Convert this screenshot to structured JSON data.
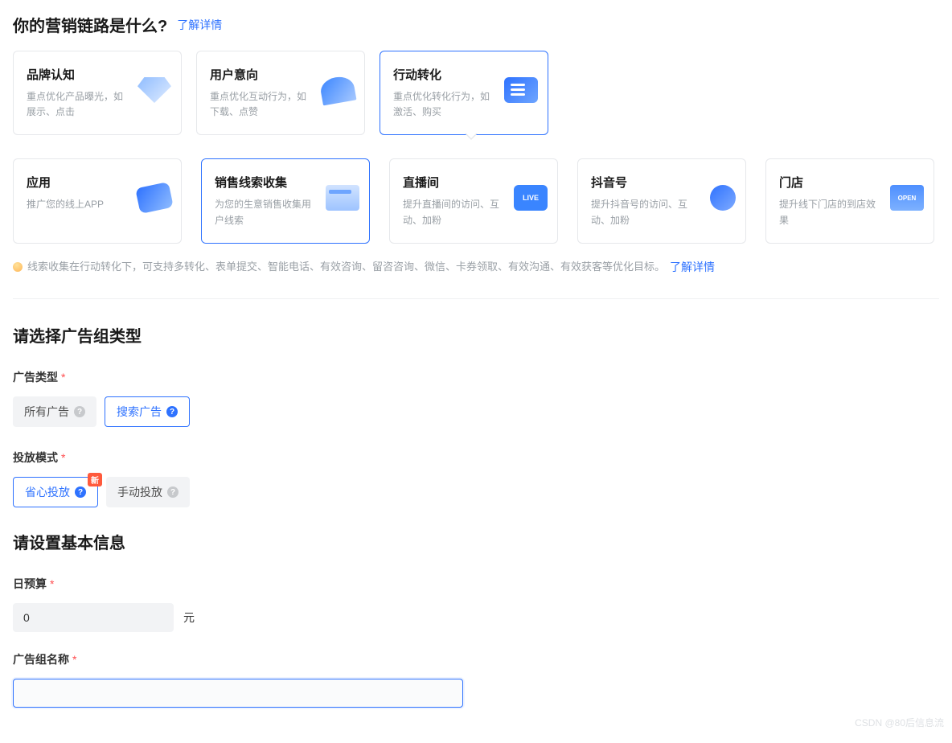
{
  "s1": {
    "title": "你的营销链路是什么?",
    "link": "了解详情",
    "cards": [
      {
        "title": "品牌认知",
        "desc": "重点优化产品曝光，如展示、点击"
      },
      {
        "title": "用户意向",
        "desc": "重点优化互动行为，如下载、点赞"
      },
      {
        "title": "行动转化",
        "desc": "重点优化转化行为，如激活、购买"
      }
    ],
    "sub": [
      {
        "title": "应用",
        "desc": "推广您的线上APP"
      },
      {
        "title": "销售线索收集",
        "desc": "为您的生意销售收集用户线索"
      },
      {
        "title": "直播间",
        "desc": "提升直播间的访问、互动、加粉"
      },
      {
        "title": "抖音号",
        "desc": "提升抖音号的访问、互动、加粉"
      },
      {
        "title": "门店",
        "desc": "提升线下门店的到店效果"
      }
    ],
    "hint": "线索收集在行动转化下，可支持多转化、表单提交、智能电话、有效咨询、留咨咨询、微信、卡券领取、有效沟通、有效获客等优化目标。",
    "hintLink": "了解详情"
  },
  "s2": {
    "title": "请选择广告组类型",
    "adTypeLabel": "广告类型",
    "adTypes": [
      "所有广告",
      "搜索广告"
    ],
    "modeLabel": "投放模式",
    "modes": [
      "省心投放",
      "手动投放"
    ],
    "newBadge": "新"
  },
  "s3": {
    "title": "请设置基本信息",
    "budgetLabel": "日预算",
    "budgetValue": "0",
    "budgetUnit": "元",
    "nameLabel": "广告组名称",
    "nameValue": ""
  },
  "watermark": "CSDN @80后信息流"
}
